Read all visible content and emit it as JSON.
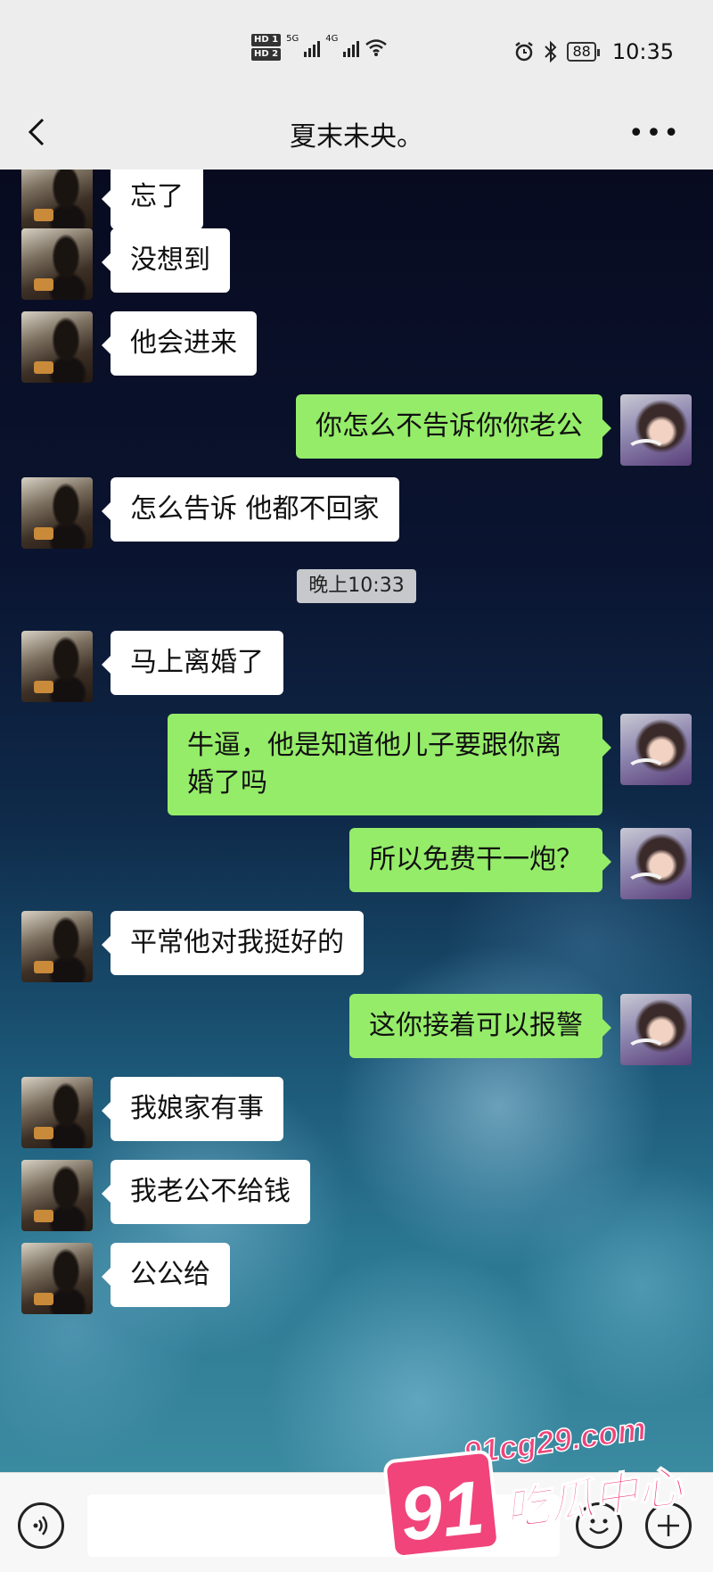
{
  "status_bar": {
    "hd1": "HD 1",
    "hd2": "HD 2",
    "net1": "5G",
    "net2": "4G",
    "battery": "88",
    "time": "10:35"
  },
  "nav": {
    "title": "夏末未央。"
  },
  "messages": [
    {
      "side": "left",
      "text": "忘了"
    },
    {
      "side": "left",
      "text": "没想到"
    },
    {
      "side": "left",
      "text": "他会进来"
    },
    {
      "side": "right",
      "text": "你怎么不告诉你你老公"
    },
    {
      "side": "left",
      "text": "怎么告诉 他都不回家"
    },
    {
      "side": "left",
      "text": "马上离婚了"
    },
    {
      "side": "right",
      "text": "牛逼，他是知道他儿子要跟你离婚了吗"
    },
    {
      "side": "right",
      "text": "所以免费干一炮？"
    },
    {
      "side": "left",
      "text": "平常他对我挺好的"
    },
    {
      "side": "right",
      "text": "这你接着可以报警"
    },
    {
      "side": "left",
      "text": "我娘家有事"
    },
    {
      "side": "left",
      "text": "我老公不给钱"
    },
    {
      "side": "left",
      "text": "公公给"
    }
  ],
  "timestamp": "晚上10:33",
  "watermark": {
    "url": "91cg29.com",
    "number": "91",
    "name": "吃瓜中心"
  },
  "icons": [
    "back-icon",
    "more-icon",
    "voice-icon",
    "emoji-icon",
    "plus-icon"
  ]
}
